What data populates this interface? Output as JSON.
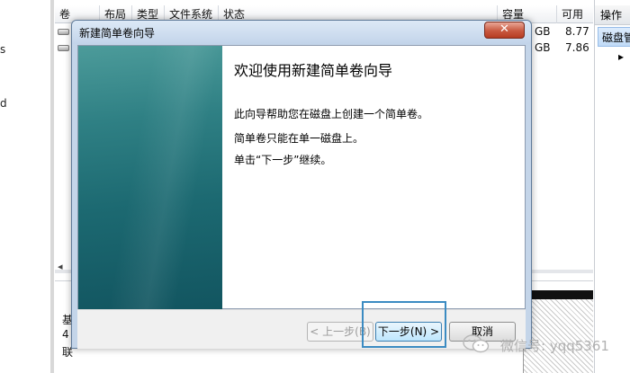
{
  "background": {
    "left_edge_glyphs": [
      "s",
      "d"
    ],
    "list_columns": [
      "卷",
      "布局",
      "类型",
      "文件系统",
      "状态",
      "容量",
      "可用"
    ],
    "rows": [
      {
        "capacity_suffix": "GB",
        "free": "8.77"
      },
      {
        "capacity_suffix": "GB",
        "free": "7.86"
      }
    ],
    "actions": {
      "header": "操作",
      "item": "磁盘管",
      "more_arrow": "▸"
    },
    "scroll_left_glyph": "◂",
    "disk_labels": [
      "基",
      "4",
      "联"
    ]
  },
  "wizard": {
    "title": "新建简单卷向导",
    "close_glyph": "✕",
    "heading": "欢迎使用新建简单卷向导",
    "line1": "此向导帮助您在磁盘上创建一个简单卷。",
    "line2": "简单卷只能在单一磁盘上。",
    "line3": "单击“下一步”继续。",
    "buttons": {
      "back": "< 上一步(B)",
      "next": "下一步(N) >",
      "cancel": "取消"
    }
  },
  "watermark": {
    "text": "微信号: yqq5361",
    "icon": "wechat-icon"
  },
  "colors": {
    "banner_teal": "#1c6971",
    "highlight_border": "#3b8bc2",
    "close_red": "#c85940"
  }
}
